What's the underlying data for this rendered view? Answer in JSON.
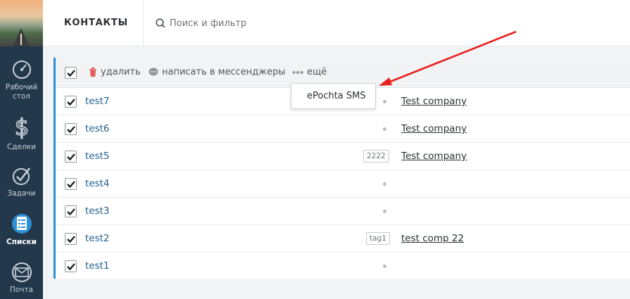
{
  "sidebar": {
    "items": [
      {
        "label": "Рабочий стол",
        "icon": "dashboard-icon"
      },
      {
        "label": "Сделки",
        "icon": "dollar-icon"
      },
      {
        "label": "Задачи",
        "icon": "check-circle-icon"
      },
      {
        "label": "Списки",
        "icon": "lists-icon",
        "active": true
      },
      {
        "label": "Почта",
        "icon": "mail-icon"
      }
    ]
  },
  "header": {
    "title": "КОНТАКТЫ",
    "search_placeholder": "Поиск и фильтр"
  },
  "toolbar": {
    "delete_label": "удалить",
    "messenger_label": "написать в мессенджеры",
    "more_label": "ещё"
  },
  "dropdown": {
    "items": [
      "ePochta SMS"
    ]
  },
  "rows": [
    {
      "name": "test7",
      "tag": "",
      "company": "Test company"
    },
    {
      "name": "test6",
      "tag": "",
      "company": "Test company"
    },
    {
      "name": "test5",
      "tag": "2222",
      "company": "Test company"
    },
    {
      "name": "test4",
      "tag": "",
      "company": ""
    },
    {
      "name": "test3",
      "tag": "",
      "company": ""
    },
    {
      "name": "test2",
      "tag": "tag1",
      "company": "test comp 22"
    },
    {
      "name": "test1",
      "tag": "",
      "company": ""
    }
  ],
  "colors": {
    "sidebar_bg": "#23384a",
    "accent": "#2d8fd5",
    "link": "#1f5f8f",
    "delete_icon": "#e0605a",
    "annotation_arrow": "#e8201f"
  }
}
